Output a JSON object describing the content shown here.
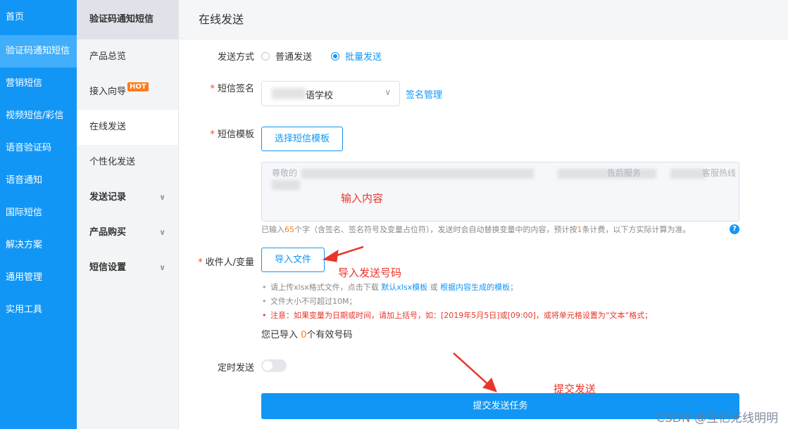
{
  "nav_primary": {
    "items": [
      {
        "label": "首页"
      },
      {
        "label": "验证码通知短信"
      },
      {
        "label": "营销短信"
      },
      {
        "label": "视频短信/彩信"
      },
      {
        "label": "语音验证码"
      },
      {
        "label": "语音通知"
      },
      {
        "label": "国际短信"
      },
      {
        "label": "解决方案"
      },
      {
        "label": "通用管理"
      },
      {
        "label": "实用工具"
      }
    ],
    "active_index": 1,
    "color": "#1296f5"
  },
  "nav_secondary": {
    "title": "验证码通知短信",
    "items": [
      {
        "label": "产品总览"
      },
      {
        "label": "接入向导",
        "badge": "HOT"
      },
      {
        "label": "在线发送"
      },
      {
        "label": "个性化发送"
      },
      {
        "label": "发送记录"
      },
      {
        "label": "产品购买"
      },
      {
        "label": "短信设置"
      }
    ]
  },
  "page": {
    "title": "在线发送",
    "send_mode": {
      "label": "发送方式",
      "options": [
        "普通发送",
        "批量发送"
      ],
      "selected": "批量发送"
    },
    "signature": {
      "label": "短信签名",
      "value": "语学校",
      "manage_link": "签名管理"
    },
    "template": {
      "label": "短信模板",
      "button": "选择短信模板",
      "content_start": "尊敬的",
      "content_mid": "告后服务",
      "content_end": "客服热线"
    },
    "content_hint": {
      "prefix": "已输入",
      "count": "65",
      "suffix": "个字（含签名、签名符号及变量占位符），发送时会自动替换变量中的内容，预计按",
      "bill": "1",
      "suffix2": "条计费，以下方实际计算为准。"
    },
    "recipients": {
      "label": "收件人/变量",
      "button": "导入文件",
      "tip1_prefix": "请上传xlsx格式文件，点击下载 ",
      "tip1_link1": "默认xlsx模板",
      "tip1_or": " 或 ",
      "tip1_link2": "根据内容生成的模板",
      "tip1_end": "；",
      "tip2": "文件大小不可超过10M；",
      "tip3": "注意：如果变量为日期或时间，请加上括号，如：[2019年5月5日]或[09:00]，或将单元格设置为“文本”格式；",
      "imported_prefix": "您已导入 ",
      "imported_count": "0",
      "imported_suffix": "个有效号码"
    },
    "schedule": {
      "label": "定时发送",
      "enabled": false
    },
    "submit": "提交发送任务"
  },
  "annotations": {
    "input_content": "输入内容",
    "import_numbers": "导入发送号码",
    "submit_send": "提交发送"
  },
  "watermark": "CSDN @互亿无线明明"
}
